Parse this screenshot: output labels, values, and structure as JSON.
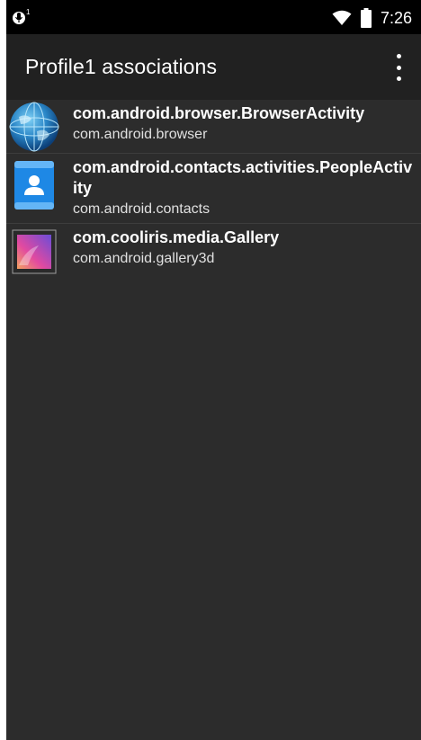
{
  "status_bar": {
    "time": "7:26",
    "notification_count": "1",
    "icons": [
      "mic-notification-icon",
      "wifi-icon",
      "battery-icon"
    ]
  },
  "app_bar": {
    "title": "Profile1 associations",
    "overflow_icon": "more-vert-icon"
  },
  "associations": [
    {
      "title": "com.android.browser.BrowserActivity",
      "package": "com.android.browser",
      "icon": "browser-globe-icon"
    },
    {
      "title": "com.android.contacts.activities.PeopleActivity",
      "package": "com.android.contacts",
      "icon": "contacts-icon"
    },
    {
      "title": "com.cooliris.media.Gallery",
      "package": "com.android.gallery3d",
      "icon": "gallery-icon"
    }
  ],
  "colors": {
    "background": "#2c2c2c",
    "app_bar": "#212121",
    "status_bar": "#000000",
    "text_primary": "#ffffff",
    "text_secondary": "#e0e0e0"
  }
}
